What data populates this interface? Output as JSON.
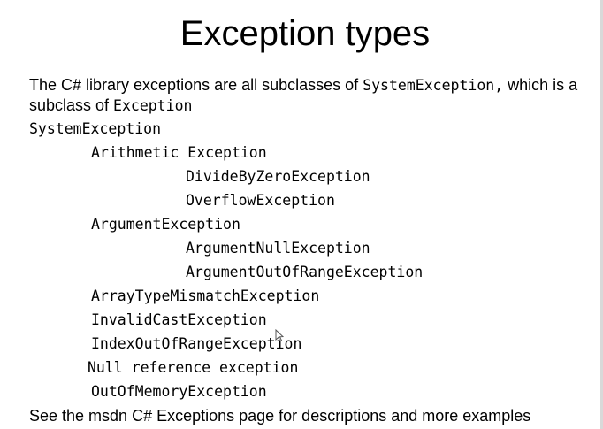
{
  "slide": {
    "title": "Exception types",
    "intro": {
      "part1": "The C# library exceptions are all subclasses of ",
      "code1": "SystemException,",
      "part2": " which is a subclass of ",
      "code2": "Exception"
    },
    "tree": {
      "root": "SystemException",
      "arithmetic": "Arithmetic Exception",
      "divide_by_zero": "DivideByZeroException",
      "overflow": "OverflowException",
      "argument": "ArgumentException",
      "argument_null": "ArgumentNullException",
      "argument_out_of_range": "ArgumentOutOfRangeException",
      "array_type_mismatch": "ArrayTypeMismatchException",
      "invalid_cast": "InvalidCastException",
      "index_out_of_range": "IndexOutOfRangeException",
      "null_reference": "Null reference exception",
      "out_of_memory": "OutOfMemoryException"
    },
    "footer": "See the msdn C# Exceptions page for descriptions and more examples"
  }
}
